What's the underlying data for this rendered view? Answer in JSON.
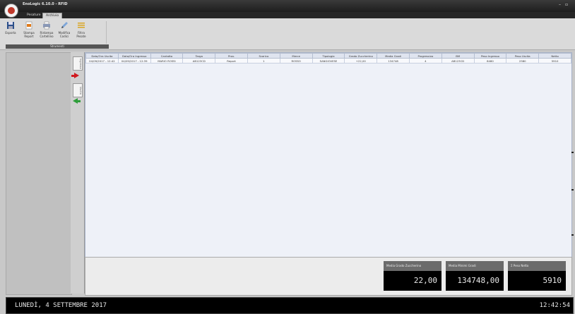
{
  "app": {
    "title": "EnoLogic 6.10.0 - RFID"
  },
  "tabs": [
    {
      "label": "Pesature"
    },
    {
      "label": "Archivio"
    }
  ],
  "ribbon": {
    "buttons": [
      {
        "label": "Esporta"
      },
      {
        "label": "Stampa Report"
      },
      {
        "label": "Ristampa Cartellino"
      },
      {
        "label": "Modifica Codici"
      },
      {
        "label": "Filtra Pesate"
      }
    ],
    "group_label": "Strumenti"
  },
  "side_tabs": [
    {
      "label": "Ingresso"
    },
    {
      "label": "Uscita"
    }
  ],
  "table": {
    "columns": [
      "Data/Ora Uscita",
      "Data/Ora Ingresso",
      "Cantatto",
      "Targa",
      "Prov.",
      "Scarico",
      "Merce",
      "Tipologia",
      "Grado Zuccherino",
      "Media Gradi",
      "Progressivo",
      "BM",
      "Peso Ingresso",
      "Peso Uscita",
      "Netto"
    ],
    "rows": [
      [
        "04/09/2017 - 12:42",
        "04/09/2017 - 12:39",
        "MARIO ROSSI",
        "AB123CD",
        "Report",
        "1",
        "ROSSO",
        "SANGIOVESE",
        "+22,00",
        "134748",
        "4",
        "AB123CD",
        "8480",
        "2580",
        "5910"
      ]
    ]
  },
  "summary": [
    {
      "label": "Media Grado Zuccherino",
      "value": "22,00"
    },
    {
      "label": "Media Minimi Gradi",
      "value": "134748,00"
    },
    {
      "label": "Σ Peso Netto",
      "value": "5910"
    }
  ],
  "status": {
    "date": "LUNEDÌ, 4 SETTEMBRE 2017",
    "time": "12:42:54"
  }
}
